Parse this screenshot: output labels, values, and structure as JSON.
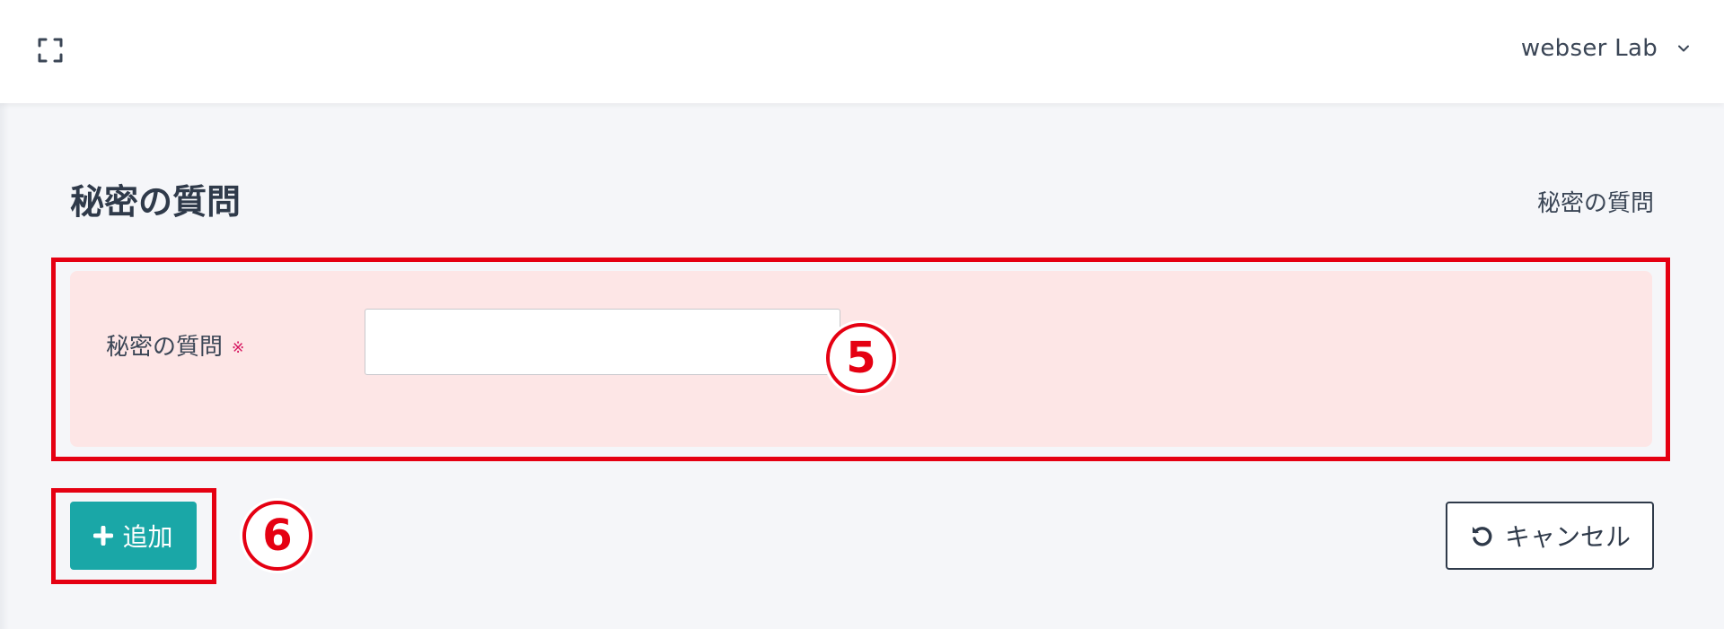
{
  "header": {
    "user_name": "webser Lab",
    "fullscreen_icon": "fullscreen-icon",
    "chevron_icon": "chevron-down-icon"
  },
  "page": {
    "title": "秘密の質問",
    "breadcrumb": "秘密の質問"
  },
  "form": {
    "field_label": "秘密の質問",
    "required_mark": "※",
    "field_value": "",
    "field_placeholder": ""
  },
  "actions": {
    "add_label": "追加",
    "add_icon": "plus-icon",
    "cancel_label": "キャンセル",
    "cancel_icon": "undo-icon"
  },
  "annotations": [
    {
      "label": "5"
    },
    {
      "label": "6"
    }
  ],
  "colors": {
    "annotation_red": "#e50012",
    "add_button": "#1aa7a7",
    "form_panel": "#fde6e6",
    "required_mark": "#d6145e"
  }
}
